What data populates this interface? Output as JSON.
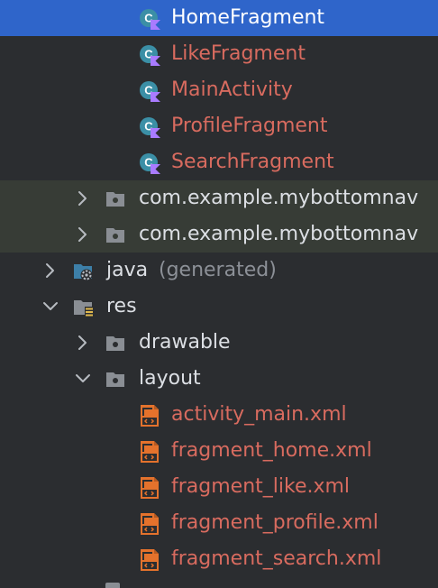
{
  "colors": {
    "selected_bg": "#2f65ca",
    "tinted_bg": "#373c36",
    "panel_bg": "#2b2d30",
    "error_text": "#d86b5f",
    "normal_text": "#dcdfe4",
    "dim_text": "#8c9097"
  },
  "classes": [
    {
      "name": "HomeFragment",
      "icon": "kotlin-class-icon",
      "selected": true
    },
    {
      "name": "LikeFragment",
      "icon": "kotlin-class-icon"
    },
    {
      "name": "MainActivity",
      "icon": "kotlin-class-icon"
    },
    {
      "name": "ProfileFragment",
      "icon": "kotlin-class-icon"
    },
    {
      "name": "SearchFragment",
      "icon": "kotlin-class-icon"
    }
  ],
  "test_packages": [
    {
      "name": "com.example.mybottomnav",
      "icon": "package-folder-icon",
      "expanded": false
    },
    {
      "name": "com.example.mybottomnav",
      "icon": "package-folder-icon",
      "expanded": false
    }
  ],
  "java_folder": {
    "name": "java",
    "suffix": "(generated)",
    "icon": "generated-source-folder-icon",
    "expanded": false
  },
  "res_folder": {
    "name": "res",
    "icon": "resources-folder-icon",
    "expanded": true
  },
  "res_children": [
    {
      "name": "drawable",
      "icon": "folder-icon",
      "expanded": false
    },
    {
      "name": "layout",
      "icon": "folder-icon",
      "expanded": true
    }
  ],
  "layout_files": [
    {
      "name": "activity_main.xml",
      "icon": "xml-layout-file-icon"
    },
    {
      "name": "fragment_home.xml",
      "icon": "xml-layout-file-icon"
    },
    {
      "name": "fragment_like.xml",
      "icon": "xml-layout-file-icon"
    },
    {
      "name": "fragment_profile.xml",
      "icon": "xml-layout-file-icon"
    },
    {
      "name": "fragment_search.xml",
      "icon": "xml-layout-file-icon"
    }
  ]
}
